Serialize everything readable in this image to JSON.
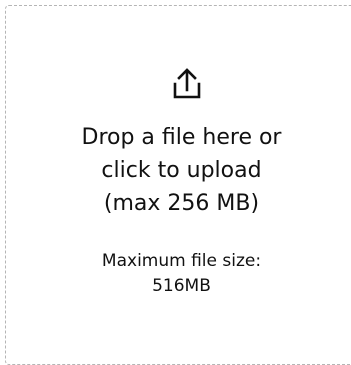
{
  "upload": {
    "icon": "upload-icon",
    "prompt_line1": "Drop a file here or",
    "prompt_line2": "click to upload",
    "prompt_line3": "(max 256 MB)",
    "limit_line1": "Maximum file size:",
    "limit_line2": "516MB"
  },
  "colors": {
    "border": "#b5b5b5",
    "text": "#111111",
    "background": "#ffffff"
  }
}
